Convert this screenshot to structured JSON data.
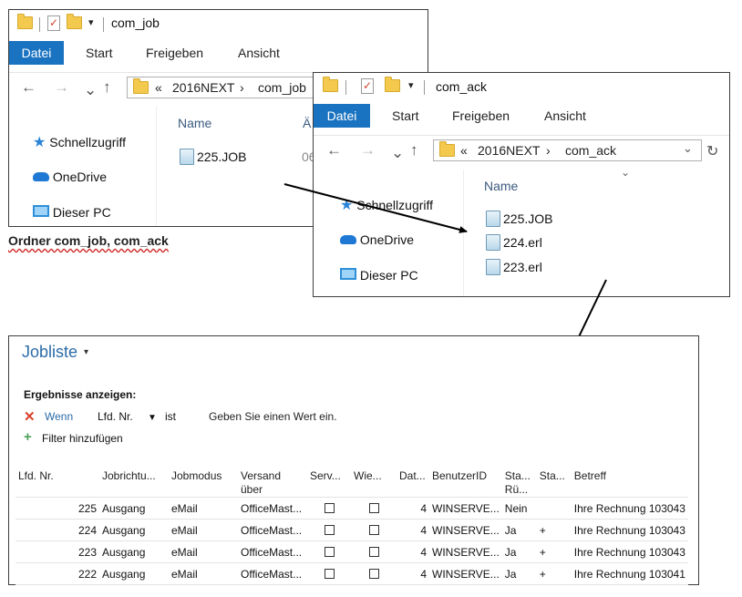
{
  "win1": {
    "title": "com_job",
    "tabs": [
      "Datei",
      "Start",
      "Freigeben",
      "Ansicht"
    ],
    "address": {
      "prefix": "«",
      "segments": [
        "2016NEXT",
        "com_job"
      ]
    },
    "sidebar": [
      "Schnellzugriff",
      "OneDrive",
      "Dieser PC"
    ],
    "columns": [
      "Name",
      "Ä"
    ],
    "files": [
      {
        "name": "225.JOB",
        "date": "06"
      }
    ]
  },
  "caption": "Ordner com_job, com_ack",
  "win2": {
    "title": "com_ack",
    "tabs": [
      "Datei",
      "Start",
      "Freigeben",
      "Ansicht"
    ],
    "address": {
      "prefix": "«",
      "segments": [
        "2016NEXT",
        "com_ack"
      ]
    },
    "sidebar": [
      "Schnellzugriff",
      "OneDrive",
      "Dieser PC"
    ],
    "column": "Name",
    "files": [
      "225.JOB",
      "224.erl",
      "223.erl"
    ]
  },
  "joblist": {
    "title": "Jobliste",
    "results_label": "Ergebnisse anzeigen:",
    "filter": {
      "when": "Wenn",
      "field": "Lfd. Nr.",
      "op": "ist",
      "placeholder": "Geben Sie einen Wert ein."
    },
    "add_filter": "Filter hinzufügen",
    "headers": [
      "Lfd. Nr.",
      "Jobrichtu...",
      "Jobmodus",
      "Versand über",
      "Serv...",
      "Wie...",
      "Dat...",
      "BenutzerID",
      "Sta... Rü...",
      "Sta...",
      "Betreff"
    ],
    "rows": [
      {
        "nr": "225",
        "richtung": "Ausgang",
        "modus": "eMail",
        "versand": "OfficeMast...",
        "dat": "4",
        "user": "WINSERVE...",
        "status1": "Nein",
        "status2": "",
        "betreff": "Ihre Rechnung 103043"
      },
      {
        "nr": "224",
        "richtung": "Ausgang",
        "modus": "eMail",
        "versand": "OfficeMast...",
        "dat": "4",
        "user": "WINSERVE...",
        "status1": "Ja",
        "status2": "+",
        "betreff": "Ihre Rechnung 103043"
      },
      {
        "nr": "223",
        "richtung": "Ausgang",
        "modus": "eMail",
        "versand": "OfficeMast...",
        "dat": "4",
        "user": "WINSERVE...",
        "status1": "Ja",
        "status2": "+",
        "betreff": "Ihre Rechnung 103043"
      },
      {
        "nr": "222",
        "richtung": "Ausgang",
        "modus": "eMail",
        "versand": "OfficeMast...",
        "dat": "4",
        "user": "WINSERVE...",
        "status1": "Ja",
        "status2": "+",
        "betreff": "Ihre Rechnung 103041"
      }
    ]
  },
  "colors": {
    "accent": "#1a73c0",
    "folder": "#f3c94e",
    "title_blue": "#2a6ba8",
    "filter_x": "#d9412b",
    "plus_green": "#4aa05a"
  }
}
